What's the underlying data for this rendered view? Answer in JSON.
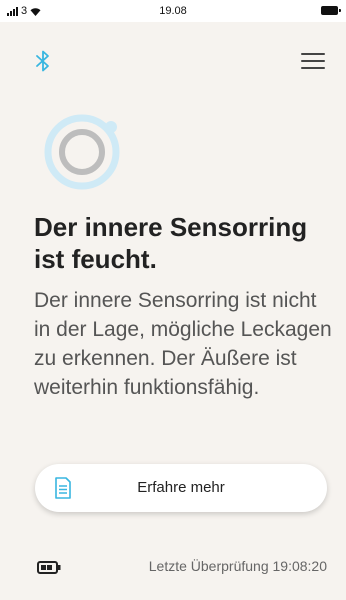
{
  "status_bar": {
    "carrier": "3",
    "time": "19.08",
    "icons": [
      "signal-icon",
      "wifi-icon",
      "battery-icon"
    ]
  },
  "header": {
    "icons": [
      "bluetooth-icon",
      "menu-icon"
    ]
  },
  "alert": {
    "icon": "sensor-ring-icon",
    "title": "Der innere Sensorring ist feucht.",
    "description": "Der innere Sensorring ist nicht in der Lage, mögliche Leckagen zu erkennen. Der Äußere ist weiterhin funktionsfähig."
  },
  "learn_more_button": {
    "label": "Erfahre mehr",
    "icon": "document-icon"
  },
  "footer": {
    "battery_icon": "battery-icon",
    "last_check_label": "Letzte Überprüfung",
    "last_check_time": "19:08:20"
  },
  "colors": {
    "background": "#f6f3ef",
    "accent": "#38b6e0",
    "ring_inner": "#bdbdbd",
    "ring_outer": "#cfeaf6"
  }
}
